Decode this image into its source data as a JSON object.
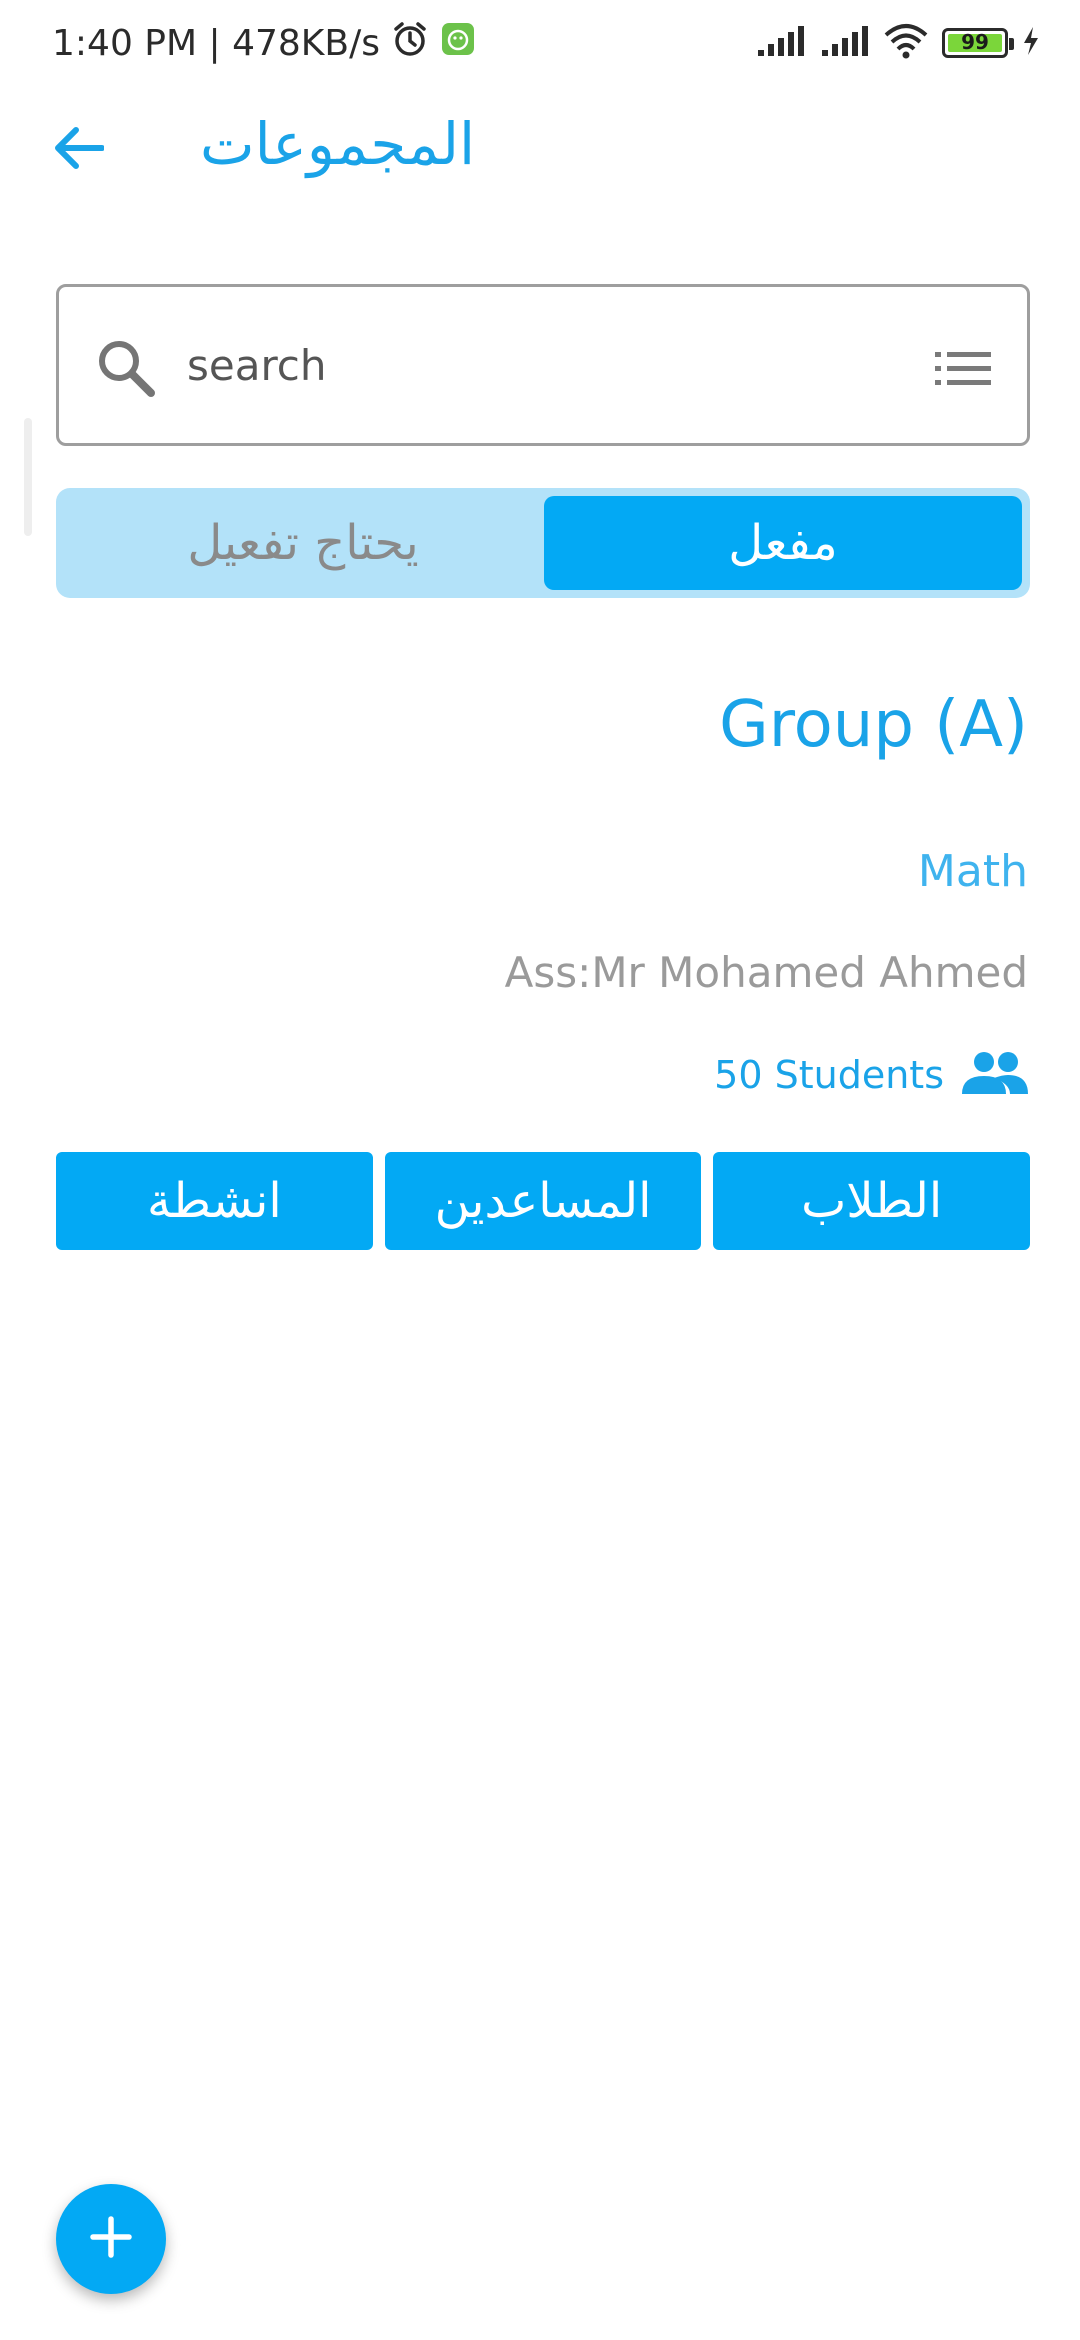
{
  "status_bar": {
    "time_speed": "1:40 PM | 478KB/s",
    "battery": "99",
    "icons": [
      "alarm-icon",
      "app-notification-icon",
      "signal-icon",
      "signal-icon",
      "wifi-icon",
      "battery-icon",
      "charging-icon"
    ]
  },
  "app_bar": {
    "title": "المجموعات",
    "back_icon": "arrow-back-icon"
  },
  "search": {
    "placeholder": "search",
    "value": "",
    "icon": "search-icon",
    "filter_icon": "list-filter-icon"
  },
  "segment": {
    "inactive_label": "يحتاج تفعيل",
    "active_label": "مفعل"
  },
  "group": {
    "title": "Group (A)",
    "subject": "Math",
    "assistant": "Ass:Mr Mohamed Ahmed",
    "students": "50 Students",
    "students_icon": "people-icon",
    "buttons": {
      "activities": "انشطة",
      "assistants": "المساعدين",
      "students": "الطلاب"
    }
  },
  "fab": {
    "icon": "plus-icon"
  },
  "colors": {
    "accent": "#03a9f4",
    "title_blue": "#1aa3e8",
    "segment_bg": "#b3e2f9",
    "muted_text": "#9a9a9a"
  }
}
